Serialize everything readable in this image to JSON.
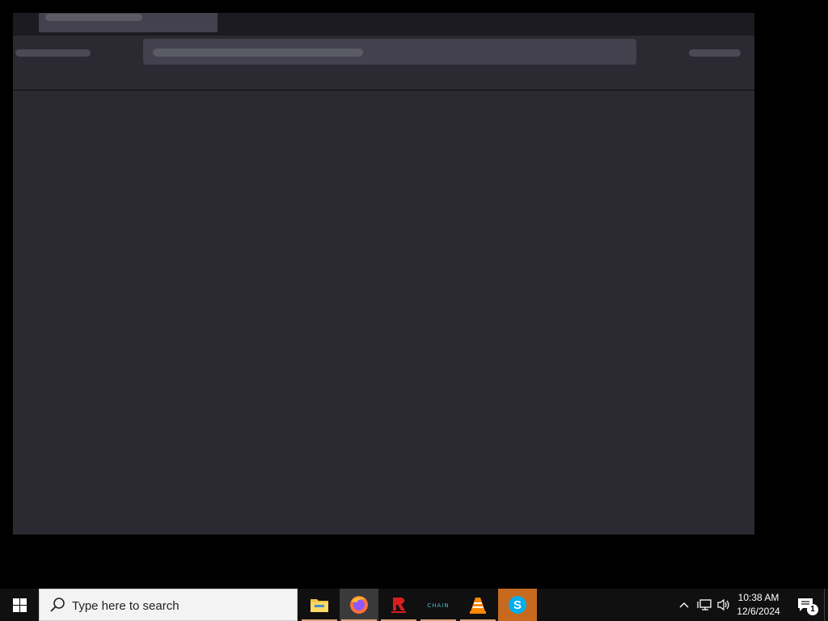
{
  "taskbar": {
    "search_placeholder": "Type here to search",
    "apps": [
      {
        "name": "File Explorer",
        "icon": "folder-icon"
      },
      {
        "name": "Firefox",
        "icon": "firefox-icon"
      },
      {
        "name": "Red app",
        "icon": "red-logo-icon"
      },
      {
        "name": "Chain",
        "icon": "chain-logo-icon",
        "label": "CHAIN"
      },
      {
        "name": "VLC media player",
        "icon": "vlc-icon"
      },
      {
        "name": "Skype",
        "icon": "skype-icon",
        "letter": "S"
      }
    ],
    "tray": {
      "time": "10:38 AM",
      "date": "12/6/2024",
      "notification_count": "1"
    }
  },
  "colors": {
    "window_bg": "#2b2a33",
    "tabstrip_bg": "#1c1b22",
    "skeleton": "#5b5b66",
    "taskbar_bg": "#101010",
    "skype_active": "#c76a1f"
  }
}
